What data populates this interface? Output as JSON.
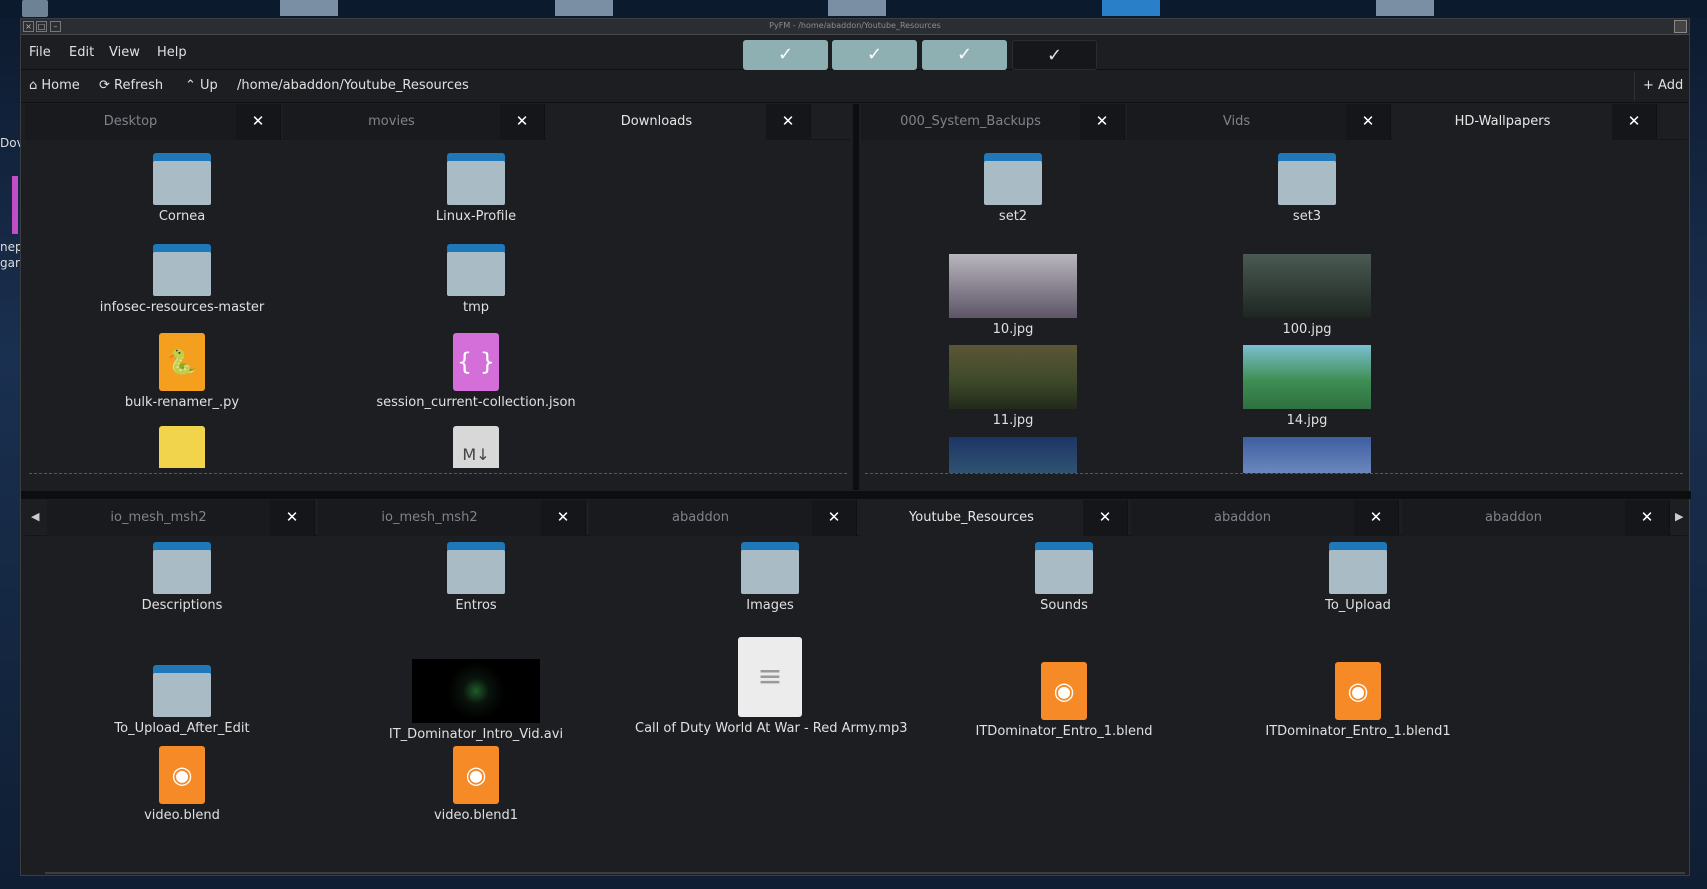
{
  "window": {
    "title": "PyFM - /home/abaddon/Youtube_Resources"
  },
  "desktop": {
    "side_text": [
      "Dov",
      "nep",
      "gar"
    ]
  },
  "menu": [
    "File",
    "Edit",
    "View",
    "Help"
  ],
  "checks": [
    "✓",
    "✓",
    "✓",
    "✓"
  ],
  "toolbar": {
    "home": "Home",
    "refresh": "Refresh",
    "up": "Up",
    "path": "/home/abaddon/Youtube_Resources",
    "add": "Add"
  },
  "top_left": {
    "tabs": [
      "Desktop",
      "movies",
      "Downloads"
    ],
    "items": [
      {
        "type": "folder",
        "label": "Cornea"
      },
      {
        "type": "folder",
        "label": "Linux-Profile"
      },
      {
        "type": "folder",
        "label": "infosec-resources-master"
      },
      {
        "type": "folder",
        "label": "tmp"
      },
      {
        "type": "py",
        "label": "bulk-renamer_.py"
      },
      {
        "type": "json",
        "label": "session_current-collection.json"
      }
    ]
  },
  "top_right": {
    "tabs": [
      "000_System_Backups",
      "Vids",
      "HD-Wallpapers"
    ],
    "items": [
      {
        "type": "folder",
        "label": "set2"
      },
      {
        "type": "folder",
        "label": "set3"
      },
      {
        "type": "image",
        "label": "10.jpg",
        "color": "#8a8f9c"
      },
      {
        "type": "image",
        "label": "100.jpg",
        "color": "#3d4a43"
      },
      {
        "type": "image",
        "label": "11.jpg",
        "color": "#6a6238"
      },
      {
        "type": "image",
        "label": "14.jpg",
        "color": "#4f9a6a"
      }
    ]
  },
  "bottom": {
    "tabs": [
      "io_mesh_msh2",
      "io_mesh_msh2",
      "abaddon",
      "Youtube_Resources",
      "abaddon",
      "abaddon"
    ],
    "items": [
      {
        "type": "folder",
        "label": "Descriptions"
      },
      {
        "type": "folder",
        "label": "Entros"
      },
      {
        "type": "folder",
        "label": "Images"
      },
      {
        "type": "folder",
        "label": "Sounds"
      },
      {
        "type": "folder",
        "label": "To_Upload"
      },
      {
        "type": "folder",
        "label": "To_Upload_After_Edit"
      },
      {
        "type": "video",
        "label": "IT_Dominator_Intro_Vid.avi"
      },
      {
        "type": "text",
        "label": "Call of Duty World At War - Red Army.mp3"
      },
      {
        "type": "blend",
        "label": "ITDominator_Entro_1.blend"
      },
      {
        "type": "blend",
        "label": "ITDominator_Entro_1.blend1"
      },
      {
        "type": "blend",
        "label": "video.blend"
      },
      {
        "type": "blend",
        "label": "video.blend1"
      }
    ]
  },
  "icons": {
    "close": "✕",
    "home": "home-icon",
    "refresh": "refresh-icon",
    "up": "up-arrow-icon",
    "add": "plus-icon"
  }
}
